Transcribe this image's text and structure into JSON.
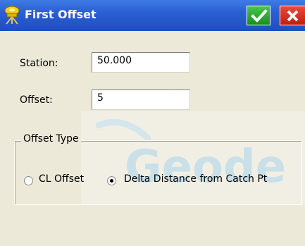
{
  "window": {
    "title": "First Offset",
    "title_bar_color": "#2a5fd3",
    "ok_button_color": "#16901d",
    "close_button_color": "#c21d10"
  },
  "icons": {
    "title": "survey-instrument-icon",
    "ok": "checkmark-icon",
    "close": "close-icon"
  },
  "form": {
    "station_label": "Station:",
    "station_value": "50.000",
    "offset_label": "Offset:",
    "offset_value": "5"
  },
  "offset_type": {
    "legend": "Offset Type",
    "options": [
      {
        "label": "CL Offset",
        "selected": false
      },
      {
        "label": "Delta Distance from Catch Pt",
        "selected": true
      }
    ]
  },
  "watermark": {
    "text": "Geode"
  }
}
